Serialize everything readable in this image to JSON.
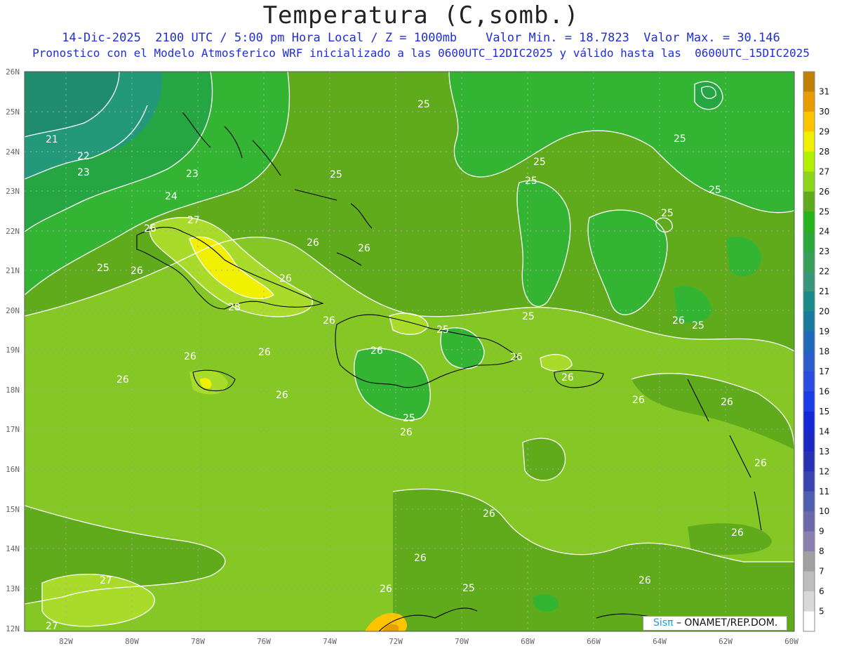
{
  "title": "Temperatura (C,somb.)",
  "subtitle1": "14-Dic-2025  2100 UTC / 5:00 pm Hora Local / Z = 1000mb    Valor Min. = 18.7823  Valor Max. = 30.146",
  "subtitle2": "Pronostico con el Modelo Atmosferico WRF inicializado a las 0600UTC_12DIC2025 y válido hasta las  0600UTC_15DIC2025",
  "credit": {
    "brand": "Sisπ",
    "text": " – ONAMET/REP.DOM."
  },
  "map": {
    "lon_range": [
      -83.3,
      -59.9
    ],
    "lat_range": [
      11.85,
      26.05
    ],
    "lat_ticks": [
      "26N",
      "25N",
      "24N",
      "23N",
      "22N",
      "21N",
      "20N",
      "19N",
      "18N",
      "17N",
      "16N",
      "15N",
      "14N",
      "13N",
      "12N"
    ],
    "lon_ticks": [
      "82W",
      "80W",
      "78W",
      "76W",
      "74W",
      "72W",
      "70W",
      "68W",
      "66W",
      "64W",
      "62W",
      "60W"
    ],
    "colors": {
      "t21": "#1f8c6e",
      "t23": "#26a643",
      "t24": "#33b533",
      "t25": "#60ab1c",
      "t26": "#85c826",
      "t27": "#a9dc2a",
      "t28": "#f0f000",
      "t29": "#ffc400",
      "t30": "#e89c00"
    },
    "contour_labels": [
      "21",
      "22",
      "23",
      "24",
      "25",
      "26",
      "27",
      "28"
    ]
  },
  "colorbar": {
    "labels": [
      "31",
      "30",
      "29",
      "28",
      "27",
      "26",
      "25",
      "24",
      "23",
      "22",
      "21",
      "20",
      "19",
      "18",
      "17",
      "16",
      "15",
      "14",
      "13",
      "12",
      "11",
      "10",
      "9",
      "8",
      "7",
      "6",
      "5"
    ],
    "colors": [
      "#c08000",
      "#e89c00",
      "#ffc400",
      "#f0f000",
      "#b2ef00",
      "#8dd61c",
      "#60ab1c",
      "#26b41c",
      "#2da83a",
      "#34a05a",
      "#3a967a",
      "#1a8a8a",
      "#1a7a9e",
      "#1e6ab8",
      "#2a5ccc",
      "#2a4ce0",
      "#1a3ce8",
      "#1428d8",
      "#1a28c4",
      "#2a30b4",
      "#3a44b0",
      "#5060b0",
      "#6a6aaa",
      "#8a80b0",
      "#a0a0a0",
      "#bdbdbd",
      "#d8d8d8",
      "#ffffff"
    ]
  }
}
